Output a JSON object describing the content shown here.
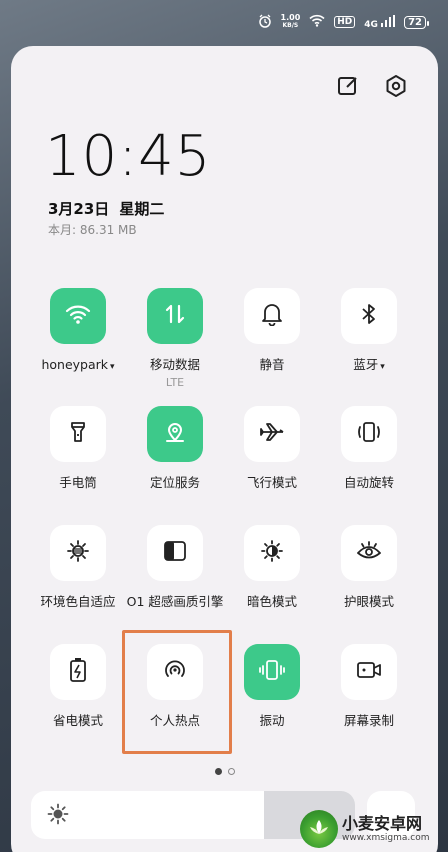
{
  "status_bar": {
    "net_speed_value": "1.00",
    "net_speed_unit": "KB/S",
    "hd_badge": "HD",
    "signal": "4G",
    "battery": "72"
  },
  "header": {
    "edit_icon": "edit-icon",
    "settings_icon": "settings-gear-icon"
  },
  "clock": {
    "time": "10:45",
    "date": "3月23日",
    "weekday": "星期二",
    "usage": "本月: 86.31 MB"
  },
  "tiles": [
    {
      "label": "honeypark",
      "dropdown": "▾",
      "icon": "wifi-icon",
      "on": true
    },
    {
      "label": "移动数据",
      "sub": "LTE",
      "icon": "mobile-data-icon",
      "on": true
    },
    {
      "label": "静音",
      "icon": "bell-icon",
      "on": false
    },
    {
      "label": "蓝牙",
      "dropdown": "▾",
      "icon": "bluetooth-icon",
      "on": false
    },
    {
      "label": "手电筒",
      "icon": "flashlight-icon",
      "on": false
    },
    {
      "label": "定位服务",
      "icon": "location-icon",
      "on": true
    },
    {
      "label": "飞行模式",
      "icon": "airplane-icon",
      "on": false
    },
    {
      "label": "自动旋转",
      "icon": "auto-rotate-icon",
      "on": false
    },
    {
      "label": "环境色自适应",
      "icon": "ambient-color-icon",
      "on": false
    },
    {
      "label": "O1 超感画质引擎",
      "icon": "display-engine-icon",
      "on": false
    },
    {
      "label": "暗色模式",
      "icon": "dark-mode-icon",
      "on": false
    },
    {
      "label": "护眼模式",
      "icon": "eye-icon",
      "on": false
    },
    {
      "label": "省电模式",
      "icon": "battery-saver-icon",
      "on": false
    },
    {
      "label": "个人热点",
      "icon": "hotspot-icon",
      "on": false
    },
    {
      "label": "振动",
      "icon": "vibrate-icon",
      "on": true
    },
    {
      "label": "屏幕录制",
      "icon": "screen-record-icon",
      "on": false
    }
  ],
  "pager": {
    "current": 1,
    "total": 2
  },
  "brightness": {
    "level_percent": 72,
    "icon": "sun-icon"
  },
  "watermark": {
    "title": "小麦安卓网",
    "url": "www.xmsigma.com"
  },
  "colors": {
    "accent_green": "#3dc98a",
    "highlight_orange": "#e27e4a",
    "panel_bg": "#f3f1f4"
  }
}
